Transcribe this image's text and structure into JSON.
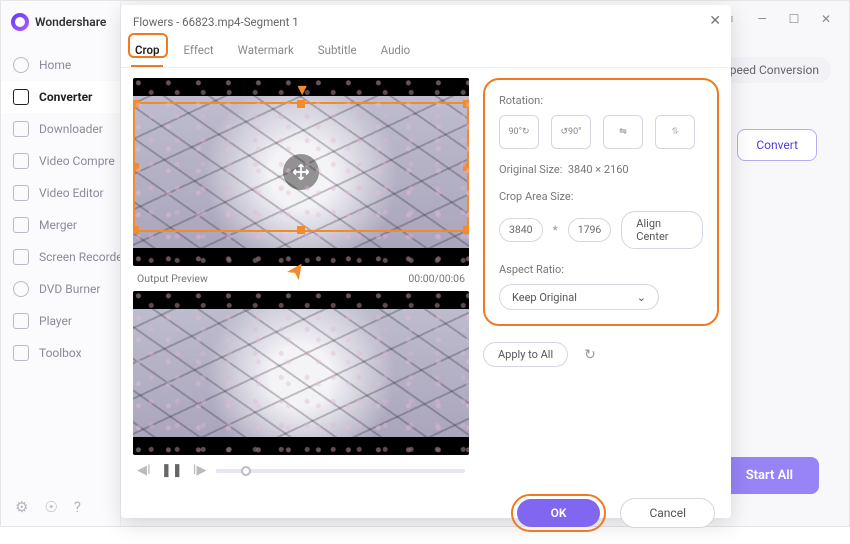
{
  "brand": "Wondershare",
  "sidebar": {
    "items": [
      {
        "label": "Home"
      },
      {
        "label": "Converter"
      },
      {
        "label": "Downloader"
      },
      {
        "label": "Video Compre"
      },
      {
        "label": "Video Editor"
      },
      {
        "label": "Merger"
      },
      {
        "label": "Screen Recorde"
      },
      {
        "label": "DVD Burner"
      },
      {
        "label": "Player"
      },
      {
        "label": "Toolbox"
      }
    ]
  },
  "main": {
    "menu_icon": "≡",
    "min_icon": "—",
    "max_icon": "☐",
    "close_icon": "✕",
    "speed_label": "Speed Conversion",
    "convert_label": "Convert",
    "start_all_label": "Start All"
  },
  "modal": {
    "title": "Flowers - 66823.mp4-Segment 1",
    "tabs": [
      {
        "label": "Crop"
      },
      {
        "label": "Effect"
      },
      {
        "label": "Watermark"
      },
      {
        "label": "Subtitle"
      },
      {
        "label": "Audio"
      }
    ],
    "output_preview": "Output Preview",
    "timecode": "00:00/00:06",
    "rotation_label": "Rotation:",
    "rot1": "90°↻",
    "rot2": "↺90°",
    "rot3": "⇋",
    "rot4": "⥮",
    "orig_size_label": "Original Size:",
    "orig_size": "3840 × 2160",
    "crop_area_label": "Crop Area Size:",
    "crop_w": "3840",
    "crop_h": "1796",
    "align_center": "Align Center",
    "aspect_label": "Aspect Ratio:",
    "aspect_value": "Keep Original",
    "apply_all": "Apply to All",
    "ok": "OK",
    "cancel": "Cancel"
  }
}
